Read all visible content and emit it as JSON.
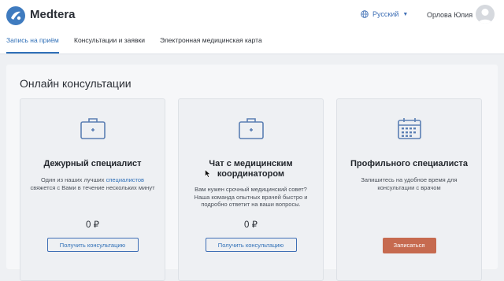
{
  "app": {
    "brand": "Medtera"
  },
  "header": {
    "language": "Русский",
    "user_name": "Орлова Юлия"
  },
  "nav": {
    "tabs": [
      {
        "label": "Запись на приём",
        "active": true
      },
      {
        "label": "Консультации и заявки",
        "active": false
      },
      {
        "label": "Электронная медицинская карта",
        "active": false
      }
    ]
  },
  "main": {
    "title": "Онлайн консультации",
    "cards": [
      {
        "icon": "medical-case-icon",
        "title": "Дежурный специалист",
        "desc_1": "Один из наших лучших",
        "desc_link": "специалистов",
        "desc_2": "свяжется с Вами в течение нескольких минут",
        "price": "0 ₽",
        "button": "Получить консультацию"
      },
      {
        "icon": "medical-case-icon",
        "title": "Чат с медицинским координатором",
        "desc": "Вам нужен срочный медицинский совет? Наша команда опытных врачей быстро и подробно ответит на ваши вопросы.",
        "price": "0 ₽",
        "button": "Получить консультацию"
      },
      {
        "icon": "calendar-icon",
        "title": "Профильного специалиста",
        "desc": "Запишитесь на удобное время для консультации с врачом",
        "button": "Записаться"
      }
    ]
  },
  "colors": {
    "accent": "#2f6fb7",
    "button_primary": "#c66a4f",
    "icon": "#5b7fb3"
  }
}
